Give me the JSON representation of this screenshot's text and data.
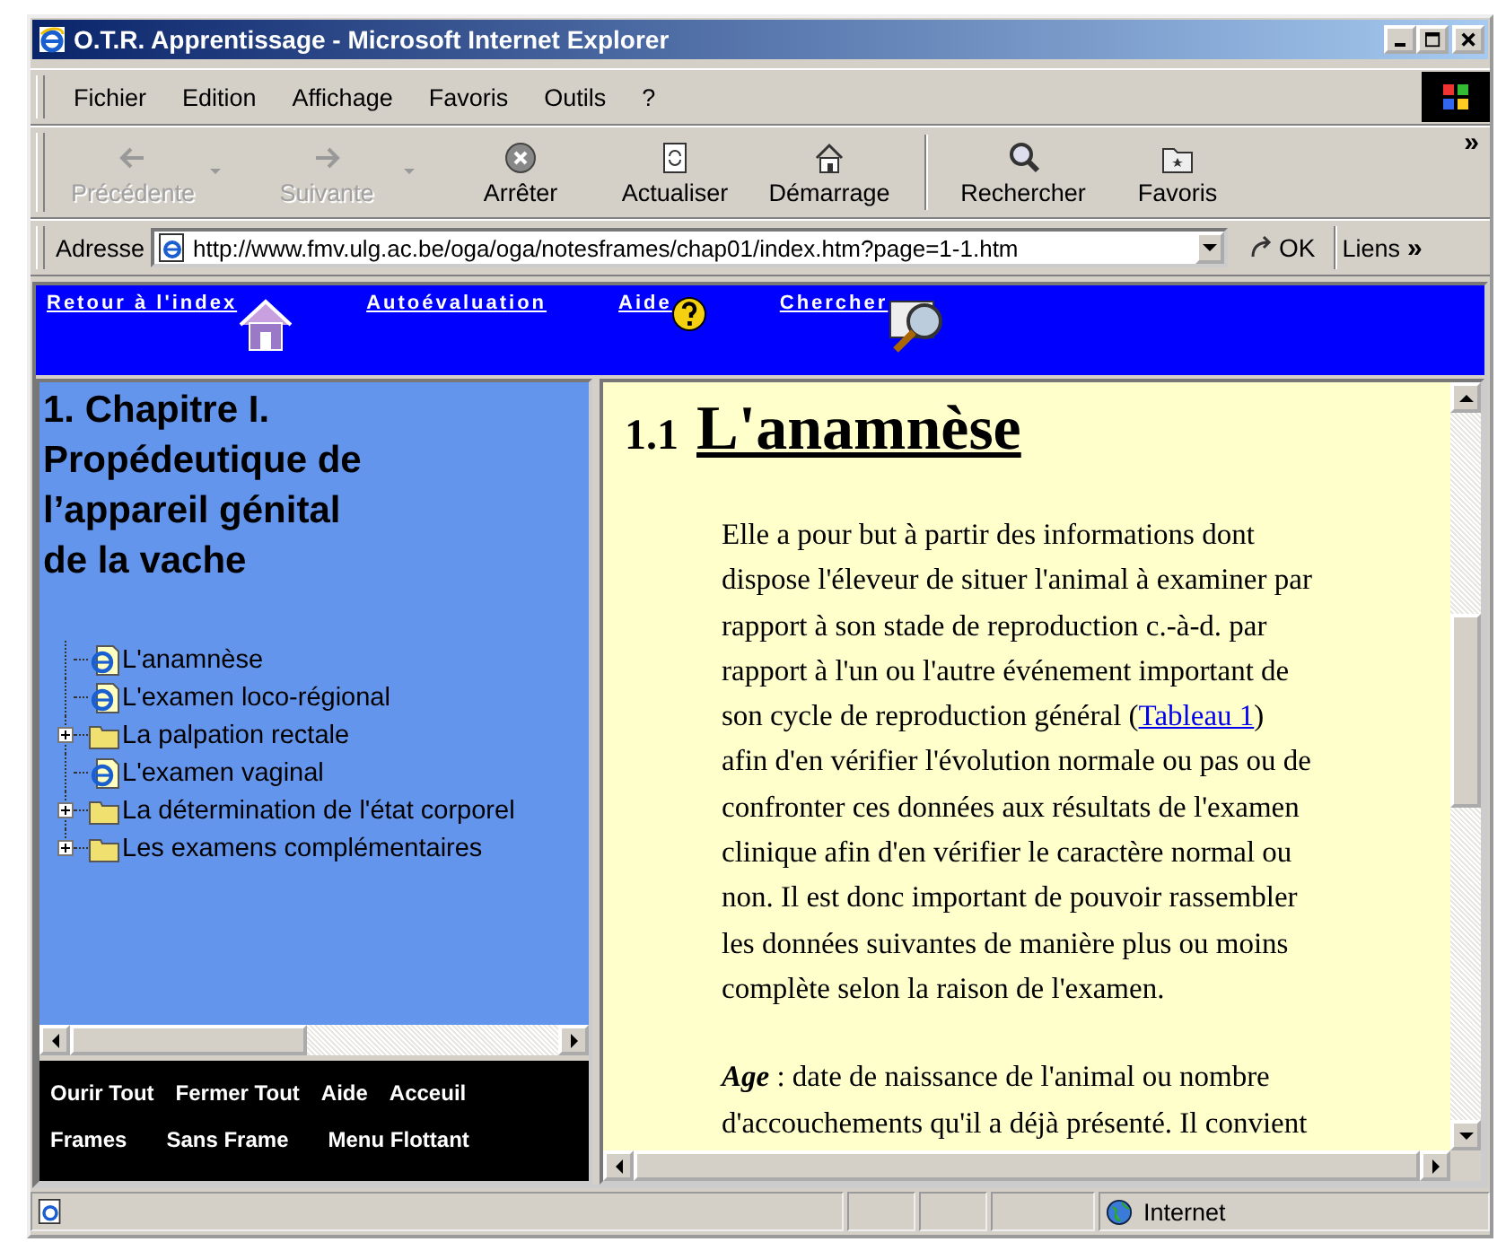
{
  "window": {
    "title": "O.T.R. Apprentissage - Microsoft Internet Explorer"
  },
  "menu": [
    {
      "label": "Fichier"
    },
    {
      "label": "Edition"
    },
    {
      "label": "Affichage"
    },
    {
      "label": "Favoris"
    },
    {
      "label": "Outils"
    },
    {
      "label": "?"
    }
  ],
  "toolbar": [
    {
      "label": "Précédente",
      "kind": "back",
      "disabled": true,
      "dropdown": true
    },
    {
      "label": "Suivante",
      "kind": "forward",
      "disabled": true,
      "dropdown": true
    },
    {
      "label": "Arrêter",
      "kind": "stop",
      "disabled": false,
      "dropdown": false
    },
    {
      "label": "Actualiser",
      "kind": "refresh",
      "disabled": false,
      "dropdown": false
    },
    {
      "label": "Démarrage",
      "kind": "home",
      "disabled": false,
      "dropdown": false
    },
    {
      "label": "Rechercher",
      "kind": "search",
      "disabled": false,
      "dropdown": false
    },
    {
      "label": "Favoris",
      "kind": "favorites",
      "disabled": false,
      "dropdown": false
    }
  ],
  "toolbar_more": "»",
  "address": {
    "label": "Adresse",
    "value": "http://www.fmv.ulg.ac.be/oga/oga/notesframes/chap01/index.htm?page=1-1.htm",
    "go": "OK"
  },
  "links": {
    "label": "Liens",
    "more": "»"
  },
  "nav": [
    {
      "label": "Retour à l'index",
      "kind": "home"
    },
    {
      "label": "Autoévaluation",
      "kind": "plain"
    },
    {
      "label": "Aide",
      "kind": "help"
    },
    {
      "label": "Chercher",
      "kind": "search"
    }
  ],
  "toc": {
    "title": [
      "1. Chapitre I.",
      "Propédeutique de",
      "l’appareil génital",
      "de la vache"
    ],
    "items": [
      {
        "label": "L'anamnèse",
        "kind": "page"
      },
      {
        "label": "L'examen loco-régional",
        "kind": "page"
      },
      {
        "label": "La palpation rectale",
        "kind": "folder",
        "expanded": false
      },
      {
        "label": "L'examen vaginal",
        "kind": "page"
      },
      {
        "label": "La détermination de l'état corporel",
        "kind": "folder",
        "expanded": false
      },
      {
        "label": "Les examens complémentaires",
        "kind": "folder",
        "expanded": false
      }
    ]
  },
  "toc_footer": [
    [
      "Ourir Tout",
      "Fermer Tout",
      "Aide",
      "Acceuil"
    ],
    [
      "Frames",
      "Sans Frame",
      "Menu Flottant"
    ]
  ],
  "article": {
    "number": "1.1",
    "title": "L'anamnèse",
    "paragraphs": [
      {
        "lines": [
          [
            {
              "kind": "text",
              "text": "Elle a pour but à partir des informations dont"
            }
          ],
          [
            {
              "kind": "text",
              "text": "dispose l'éleveur de situer l'animal à examiner par"
            }
          ],
          [
            {
              "kind": "text",
              "text": "rapport à son stade de reproduction c.-à-d. par"
            }
          ],
          [
            {
              "kind": "text",
              "text": "rapport à l'un ou l'autre événement important de"
            }
          ],
          [
            {
              "kind": "text",
              "text": "son cycle de reproduction général ("
            },
            {
              "kind": "link",
              "text": "Tableau 1"
            },
            {
              "kind": "text",
              "text": ")"
            }
          ],
          [
            {
              "kind": "text",
              "text": "afin d'en vérifier l'évolution normale ou pas ou de"
            }
          ],
          [
            {
              "kind": "text",
              "text": "confronter ces données aux résultats de l'examen"
            }
          ],
          [
            {
              "kind": "text",
              "text": "clinique afin d'en vérifier le caractère normal ou"
            }
          ],
          [
            {
              "kind": "text",
              "text": "non. Il est donc important de pouvoir rassembler"
            }
          ],
          [
            {
              "kind": "text",
              "text": "les données suivantes de manière plus ou moins"
            }
          ],
          [
            {
              "kind": "text",
              "text": "complète selon la raison de l'examen."
            }
          ]
        ]
      },
      {
        "lines": [
          [
            {
              "kind": "text",
              "text": "**Age** : date de naissance de l'animal ou nombre"
            }
          ],
          [
            {
              "kind": "text",
              "text": "d'accouchements qu'il a déjà présenté. Il convient"
            }
          ]
        ]
      }
    ]
  },
  "status": {
    "zone": "Internet"
  }
}
